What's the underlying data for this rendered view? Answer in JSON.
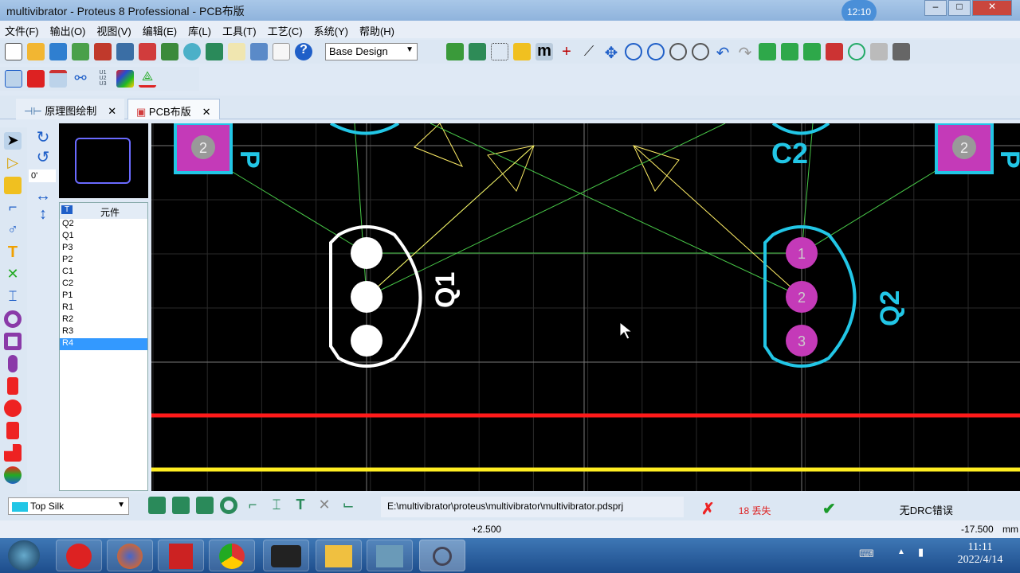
{
  "window": {
    "title": "multivibrator - Proteus 8 Professional - PCB布版",
    "clock_badge": "12:10"
  },
  "menu": [
    "文件(F)",
    "输出(O)",
    "视图(V)",
    "编辑(E)",
    "库(L)",
    "工具(T)",
    "工艺(C)",
    "系统(Y)",
    "帮助(H)"
  ],
  "toolbar": {
    "design_select": "Base Design",
    "help": "?",
    "m_label": "m"
  },
  "tabs": [
    {
      "label": "原理图绘制"
    },
    {
      "label": "PCB布版"
    }
  ],
  "left": {
    "rotation": "0'",
    "list_header": "元件",
    "components": [
      "Q2",
      "Q1",
      "P3",
      "P2",
      "C1",
      "C2",
      "P1",
      "R1",
      "R2",
      "R3",
      "R4"
    ],
    "selected": "R4"
  },
  "pcb": {
    "q1_label": "Q1",
    "q2_label": "Q2",
    "c2_label": "C2",
    "pad_num_2": "2",
    "pad_1": "1",
    "pad_2": "2",
    "pad_3": "3",
    "p_label": "P"
  },
  "status": {
    "layer": "Top Silk",
    "path": "E:\\multivibrator\\proteus\\multivibrator\\multivibrator.pdsprj",
    "missing": "18 丢失",
    "drc": "无DRC错误"
  },
  "coords": {
    "x": "+2.500",
    "y": "-17.500",
    "unit": "mm"
  },
  "taskbar": {
    "time": "11:11",
    "date": "2022/4/14"
  },
  "colors": {
    "silk": "#ffffff",
    "cyan": "#22c6e6",
    "pad": "#c43ab8",
    "ratsnest": "#48c848",
    "red": "#ff1a1a",
    "yellow": "#ffee22"
  }
}
